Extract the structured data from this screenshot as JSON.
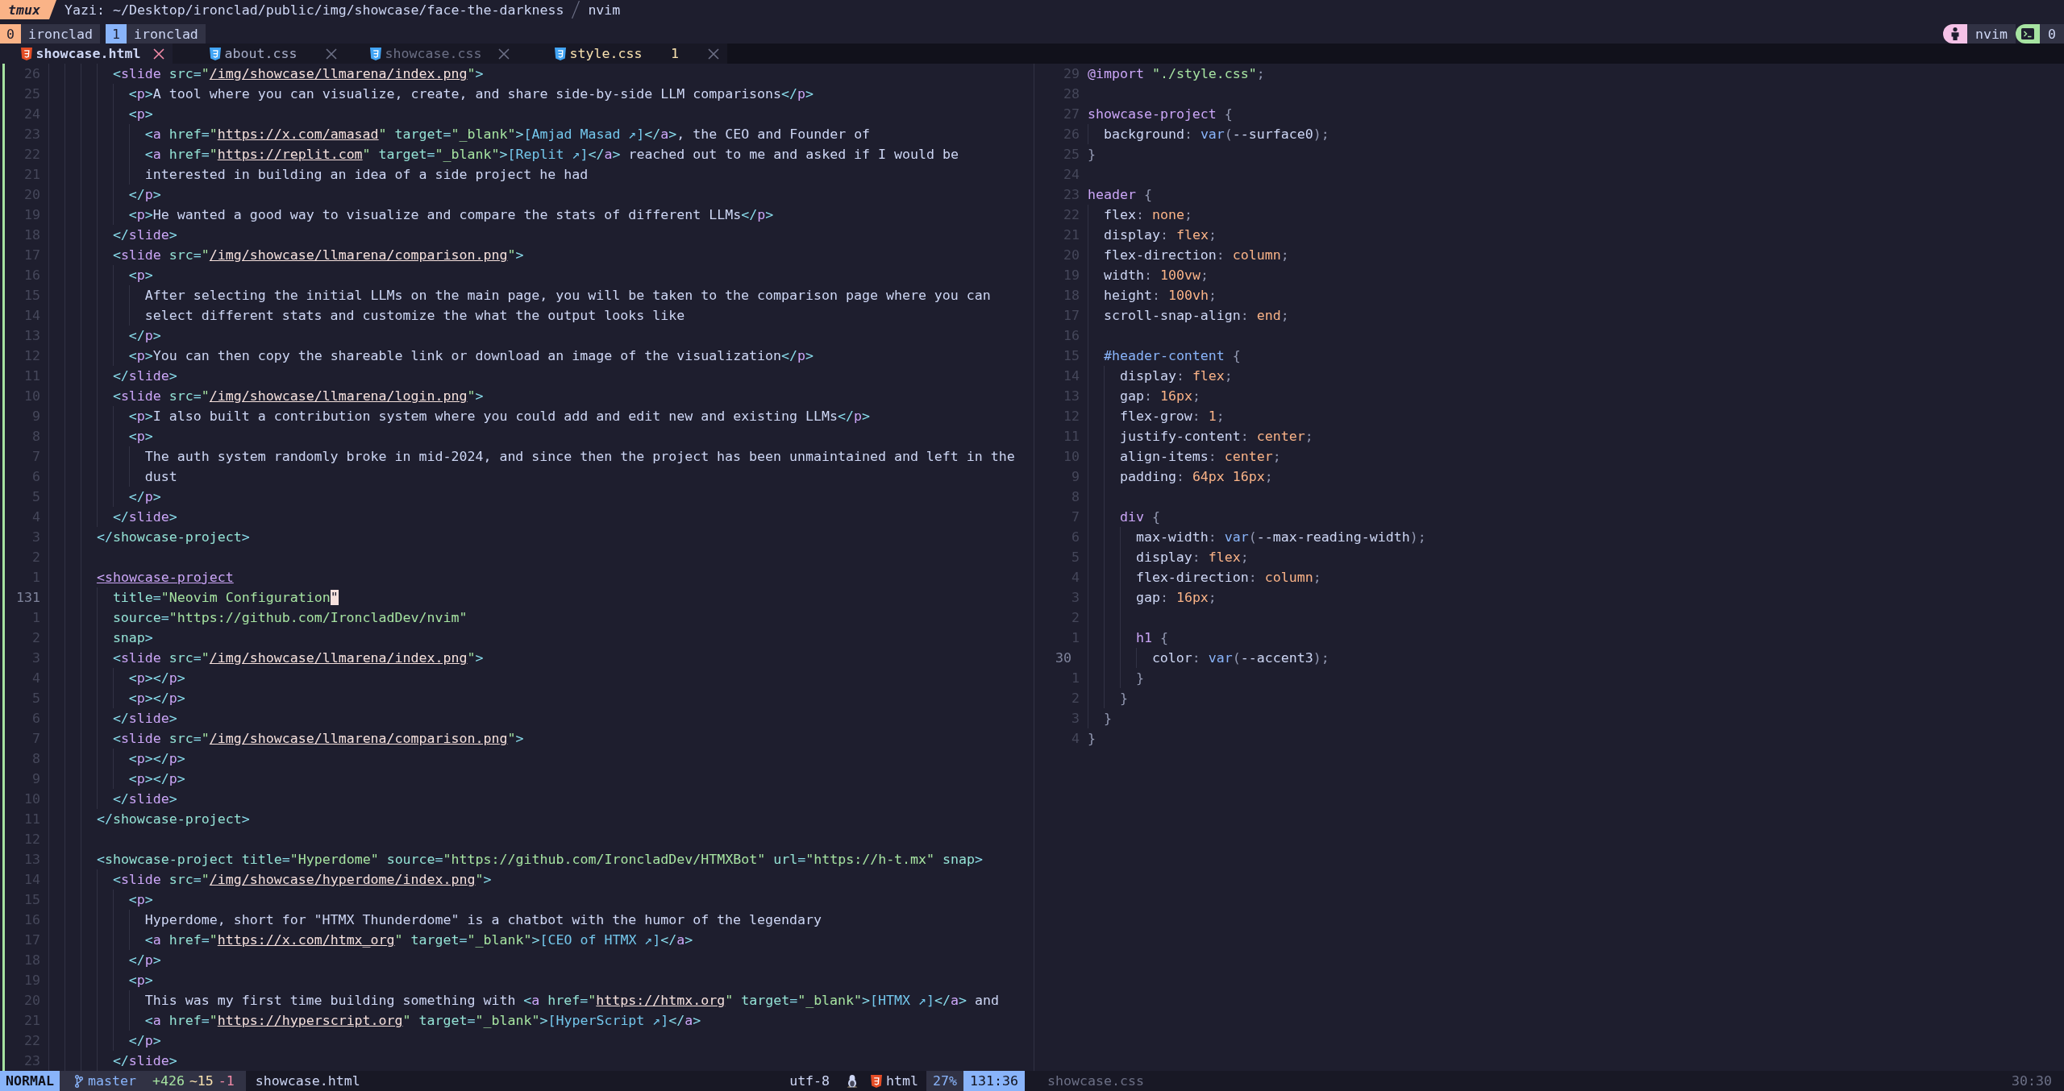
{
  "title_bar": {
    "badge": "tmux",
    "title": "Yazi: ~/Desktop/ironclad/public/img/showcase/face-the-darkness",
    "command": "nvim"
  },
  "tmux_windows": [
    {
      "index": "0",
      "name": "ironclad",
      "selected": true
    },
    {
      "index": "1",
      "name": "ironclad",
      "selected": false
    }
  ],
  "tmux_status": [
    {
      "kind": "application",
      "label": "nvim"
    },
    {
      "kind": "session",
      "label": "0"
    }
  ],
  "tabs": [
    {
      "label": "showcase.html",
      "kind": "html",
      "selected": true,
      "dimmed": false
    },
    {
      "label": "about.css",
      "kind": "css",
      "selected": false,
      "dimmed": false
    },
    {
      "label": "showcase.css",
      "kind": "css",
      "selected": false,
      "dimmed": true
    },
    {
      "label": "style.css",
      "kind": "css",
      "selected": false,
      "dimmed": false,
      "warnings": "1"
    }
  ],
  "panes": [
    {
      "kind": "html",
      "git_added": true,
      "lines_above": [
        {
          "number": "26",
          "text": "        <slide src=\"/img/showcase/llmarena/index.png\">"
        },
        {
          "number": "25",
          "text": "          <p>A tool where you can visualize, create, and share side-by-side LLM comparisons</p>"
        },
        {
          "number": "24",
          "text": "          <p>"
        },
        {
          "number": "23",
          "text": "            <a href=\"https://x.com/amasad\" target=\"_blank\">[Amjad Masad ↗]</a>, the CEO and Founder of"
        },
        {
          "number": "22",
          "text": "            <a href=\"https://replit.com\" target=\"_blank\">[Replit ↗]</a> reached out to me and asked if I would be"
        },
        {
          "number": "21",
          "text": "            interested in building an idea of a side project he had"
        },
        {
          "number": "20",
          "text": "          </p>"
        },
        {
          "number": "19",
          "text": "          <p>He wanted a good way to visualize and compare the stats of different LLMs</p>"
        },
        {
          "number": "18",
          "text": "        </slide>"
        },
        {
          "number": "17",
          "text": "        <slide src=\"/img/showcase/llmarena/comparison.png\">"
        },
        {
          "number": "16",
          "text": "          <p>"
        },
        {
          "number": "15",
          "text": "            After selecting the initial LLMs on the main page, you will be taken to the comparison page where you can"
        },
        {
          "number": "14",
          "text": "            select different stats and customize the what the output looks like"
        },
        {
          "number": "13",
          "text": "          </p>"
        },
        {
          "number": "12",
          "text": "          <p>You can then copy the shareable link or download an image of the visualization</p>"
        },
        {
          "number": "11",
          "text": "        </slide>"
        },
        {
          "number": "10",
          "text": "        <slide src=\"/img/showcase/llmarena/login.png\">"
        },
        {
          "number": "9",
          "text": "          <p>I also built a contribution system where you could add and edit new and existing LLMs</p>"
        },
        {
          "number": "8",
          "text": "          <p>"
        },
        {
          "number": "7",
          "text": "            The auth system randomly broke in mid-2024, and since then the project has been unmaintained and left in the"
        },
        {
          "number": "6",
          "text": "            dust"
        },
        {
          "number": "5",
          "text": "          </p>"
        },
        {
          "number": "4",
          "text": "        </slide>"
        },
        {
          "number": "3",
          "text": "      </showcase-project>"
        },
        {
          "number": "2"
        }
      ],
      "matched_tag_line": {
        "number": "1",
        "text": "      <showcase-project"
      },
      "cursor_line": {
        "number": "131",
        "text": "        title=\"Neovim Configuration",
        "cursor": "\""
      },
      "lines_below": [
        {
          "number": "1",
          "text": "        source=\"https://github.com/IroncladDev/nvim\""
        },
        {
          "number": "2",
          "text": "        snap>"
        },
        {
          "number": "3",
          "text": "        <slide src=\"/img/showcase/llmarena/index.png\">"
        },
        {
          "number": "4",
          "text": "          <p></p>"
        },
        {
          "number": "5",
          "text": "          <p></p>"
        },
        {
          "number": "6",
          "text": "        </slide>"
        },
        {
          "number": "7",
          "text": "        <slide src=\"/img/showcase/llmarena/comparison.png\">"
        },
        {
          "number": "8",
          "text": "          <p></p>"
        },
        {
          "number": "9",
          "text": "          <p></p>"
        },
        {
          "number": "10",
          "text": "        </slide>"
        },
        {
          "number": "11",
          "text": "      </showcase-project>"
        },
        {
          "number": "12"
        },
        {
          "number": "13",
          "text": "      <showcase-project title=\"Hyperdome\" source=\"https://github.com/IroncladDev/HTMXBot\" url=\"https://h-t.mx\" snap>"
        },
        {
          "number": "14",
          "text": "        <slide src=\"/img/showcase/hyperdome/index.png\">"
        },
        {
          "number": "15",
          "text": "          <p>"
        },
        {
          "number": "16",
          "text": "            Hyperdome, short for \"HTMX Thunderdome\" is a chatbot with the humor of the legendary"
        },
        {
          "number": "17",
          "text": "            <a href=\"https://x.com/htmx_org\" target=\"_blank\">[CEO of HTMX ↗]</a>"
        },
        {
          "number": "18",
          "text": "          </p>"
        },
        {
          "number": "19",
          "text": "          <p>"
        },
        {
          "number": "20",
          "text": "            This was my first time building something with <a href=\"https://htmx.org\" target=\"_blank\">[HTMX ↗]</a> and"
        },
        {
          "number": "21",
          "text": "            <a href=\"https://hyperscript.org\" target=\"_blank\">[HyperScript ↗]</a>"
        },
        {
          "number": "22",
          "text": "          </p>"
        },
        {
          "number": "23",
          "text": "        </slide>"
        }
      ]
    },
    {
      "kind": "css",
      "git_added": false,
      "lines_above": [
        {
          "number": "29",
          "text": "@import \"./style.css\";"
        },
        {
          "number": "28"
        },
        {
          "number": "27",
          "text": "showcase-project {"
        },
        {
          "number": "26",
          "text": "  background: var(--surface0);"
        },
        {
          "number": "25",
          "text": "}"
        },
        {
          "number": "24"
        },
        {
          "number": "23",
          "text": "header {"
        },
        {
          "number": "22",
          "text": "  flex: none;"
        },
        {
          "number": "21",
          "text": "  display: flex;"
        },
        {
          "number": "20",
          "text": "  flex-direction: column;"
        },
        {
          "number": "19",
          "text": "  width: 100vw;"
        },
        {
          "number": "18",
          "text": "  height: 100vh;"
        },
        {
          "number": "17",
          "text": "  scroll-snap-align: end;"
        },
        {
          "number": "16"
        },
        {
          "number": "15",
          "text": "  #header-content {"
        },
        {
          "number": "14",
          "text": "    display: flex;"
        },
        {
          "number": "13",
          "text": "    gap: 16px;"
        },
        {
          "number": "12",
          "text": "    flex-grow: 1;"
        },
        {
          "number": "11",
          "text": "    justify-content: center;"
        },
        {
          "number": "10",
          "text": "    align-items: center;"
        },
        {
          "number": "9",
          "text": "    padding: 64px 16px;"
        },
        {
          "number": "8"
        },
        {
          "number": "7",
          "text": "    div {"
        },
        {
          "number": "6",
          "text": "      max-width: var(--max-reading-width);"
        },
        {
          "number": "5",
          "text": "      display: flex;"
        },
        {
          "number": "4",
          "text": "      flex-direction: column;"
        },
        {
          "number": "3",
          "text": "      gap: 16px;"
        },
        {
          "number": "2"
        },
        {
          "number": "1",
          "text": "      h1 {"
        }
      ],
      "cursor_line": {
        "number": "30",
        "text": "        color: var(--accent3);"
      },
      "lines_below": [
        {
          "number": "1",
          "text": "      }"
        },
        {
          "number": "2",
          "text": "    }"
        },
        {
          "number": "3",
          "text": "  }"
        },
        {
          "number": "4",
          "text": "}"
        }
      ]
    }
  ],
  "status_line": {
    "mode": {
      "label": "NORMAL",
      "kind": "normal"
    },
    "branch": "master",
    "diff": [
      {
        "kind": "added",
        "label": "+426"
      },
      {
        "kind": "changed",
        "label": "~15"
      },
      {
        "kind": "removed",
        "label": "-1"
      }
    ],
    "file": "showcase.html",
    "encoding": "utf-8",
    "filetype": {
      "kind": "html",
      "label": "html"
    },
    "progress": "27%",
    "position": "131:36"
  },
  "inactive_status": {
    "file": "showcase.css",
    "position": "30:30"
  }
}
